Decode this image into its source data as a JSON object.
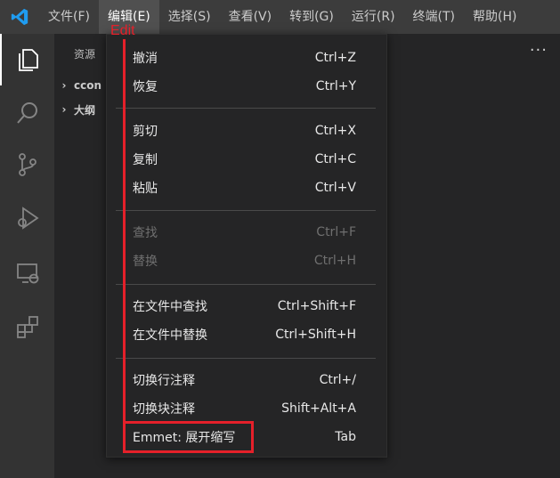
{
  "menubar": {
    "items": [
      "文件(F)",
      "编辑(E)",
      "选择(S)",
      "查看(V)",
      "转到(G)",
      "运行(R)",
      "终端(T)",
      "帮助(H)"
    ],
    "active_index": 1
  },
  "activity_bar": {
    "icons": [
      "explorer-icon",
      "search-icon",
      "source-control-icon",
      "run-debug-icon",
      "remote-explorer-icon",
      "extensions-icon"
    ]
  },
  "sidebar": {
    "header": "资源",
    "more": "···",
    "sections": [
      "ccon",
      "大纲"
    ]
  },
  "edit_menu": {
    "items": [
      {
        "label": "撤消",
        "shortcut": "Ctrl+Z",
        "enabled": true
      },
      {
        "label": "恢复",
        "shortcut": "Ctrl+Y",
        "enabled": true
      },
      {
        "label": "剪切",
        "shortcut": "Ctrl+X",
        "enabled": true
      },
      {
        "label": "复制",
        "shortcut": "Ctrl+C",
        "enabled": true
      },
      {
        "label": "粘贴",
        "shortcut": "Ctrl+V",
        "enabled": true
      },
      {
        "label": "查找",
        "shortcut": "Ctrl+F",
        "enabled": false
      },
      {
        "label": "替换",
        "shortcut": "Ctrl+H",
        "enabled": false
      },
      {
        "label": "在文件中查找",
        "shortcut": "Ctrl+Shift+F",
        "enabled": true
      },
      {
        "label": "在文件中替换",
        "shortcut": "Ctrl+Shift+H",
        "enabled": true
      },
      {
        "label": "切换行注释",
        "shortcut": "Ctrl+/",
        "enabled": true
      },
      {
        "label": "切换块注释",
        "shortcut": "Shift+Alt+A",
        "enabled": true
      },
      {
        "label": "Emmet: 展开缩写",
        "shortcut": "Tab",
        "enabled": true
      }
    ]
  },
  "annotation": {
    "label": "Edit",
    "color": "#e5202a"
  },
  "colors": {
    "accent": "#0078d4",
    "annotation": "#e5202a"
  }
}
